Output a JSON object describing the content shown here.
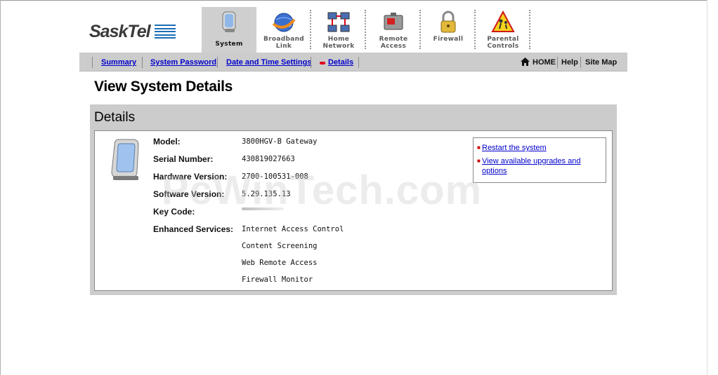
{
  "brand": {
    "logo_text": "SaskTel"
  },
  "nav_tabs": [
    {
      "label": "System",
      "icon": "system-gateway-icon",
      "active": true
    },
    {
      "label": "Broadband\nLink",
      "icon": "globe-icon",
      "active": false
    },
    {
      "label": "Home\nNetwork",
      "icon": "home-network-icon",
      "active": false
    },
    {
      "label": "Remote\nAccess",
      "icon": "remote-access-icon",
      "active": false
    },
    {
      "label": "Firewall",
      "icon": "padlock-icon",
      "active": false
    },
    {
      "label": "Parental\nControls",
      "icon": "parental-warning-icon",
      "active": false
    }
  ],
  "subnav": {
    "links": [
      "Summary",
      "System Password",
      "Date and Time Settings",
      "Details"
    ],
    "current": "Details",
    "right_links": [
      "HOME",
      "Help",
      "Site Map"
    ]
  },
  "page_title": "View System Details",
  "panel": {
    "title": "Details",
    "fields": [
      {
        "label": "Model:",
        "value": "3800HGV-B Gateway"
      },
      {
        "label": "Serial Number:",
        "value": "430819027663"
      },
      {
        "label": "Hardware Version:",
        "value": "2700-100531-008"
      },
      {
        "label": "Software Version:",
        "value": "5.29.135.13"
      },
      {
        "label": "Key Code:",
        "value": ""
      },
      {
        "label": "Enhanced Services:",
        "value": "Internet Access Control"
      }
    ],
    "enhanced_services": [
      "Internet Access Control",
      "Content Screening",
      "Web Remote Access",
      "Firewall Monitor"
    ],
    "actions": [
      "Restart the system",
      "View available upgrades and options"
    ]
  },
  "watermark": "PcWinTech.com",
  "colors": {
    "link": "#0000cc",
    "nav_bar": "#cccccc",
    "accent_red": "#e0001b",
    "brand_blue": "#1b6db5"
  }
}
